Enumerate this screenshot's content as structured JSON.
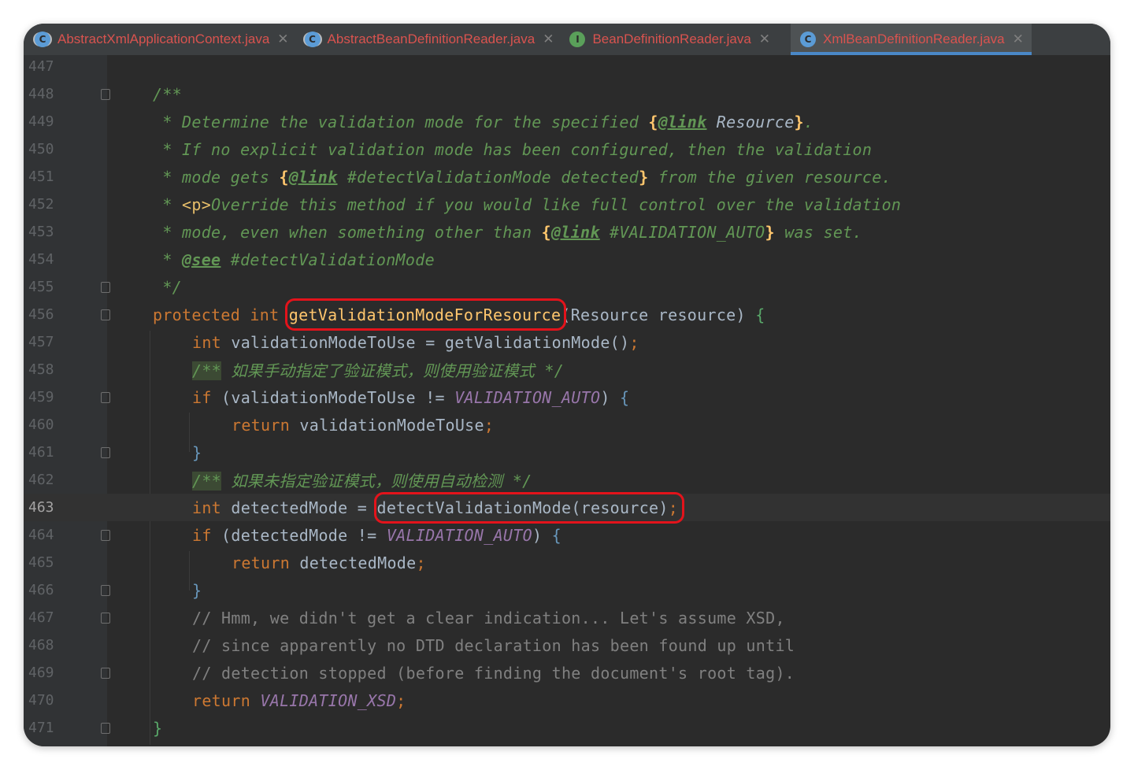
{
  "tabs": [
    {
      "label": "AbstractXmlApplicationContext.java",
      "icon": "abstract-class-icon",
      "active": false
    },
    {
      "label": "AbstractBeanDefinitionReader.java",
      "icon": "abstract-class-icon",
      "active": false
    },
    {
      "label": "BeanDefinitionReader.java",
      "icon": "interface-icon",
      "active": false
    },
    {
      "label": "XmlBeanDefinitionReader.java",
      "icon": "class-icon",
      "active": true
    }
  ],
  "close_glyph": "✕",
  "current_line": "463",
  "lines": {
    "l447": {
      "n": "447"
    },
    "l448": {
      "n": "448",
      "t1": "/**"
    },
    "l449": {
      "n": "449",
      "t1": " * Determine the validation mode for the specified ",
      "b1": "{",
      "tag": "@link",
      "ref": " Resource",
      "b2": "}",
      "t2": "."
    },
    "l450": {
      "n": "450",
      "t1": " * If no explicit validation mode has been configured, then the validation"
    },
    "l451": {
      "n": "451",
      "t1": " * mode gets ",
      "b1": "{",
      "tag": "@link",
      "ref": " #detectValidationMode detected",
      "b2": "}",
      "t2": " from the given resource."
    },
    "l452": {
      "n": "452",
      "t1": " * ",
      "html": "<p>",
      "t2": "Override this method if you would like full control over the validation"
    },
    "l453": {
      "n": "453",
      "t1": " * mode, even when something other than ",
      "b1": "{",
      "tag": "@link",
      "ref": " #VALIDATION_AUTO",
      "b2": "}",
      "t2": " was set."
    },
    "l454": {
      "n": "454",
      "t1": " * ",
      "tag": "@see",
      "t2": " #detectValidationMode"
    },
    "l455": {
      "n": "455",
      "t1": " */"
    },
    "l456": {
      "n": "456",
      "kw1": "protected",
      "kw2": "int",
      "fn": "getValidationModeForResource",
      "rest": "(Resource resource) ",
      "brace": "{"
    },
    "l457": {
      "n": "457",
      "kw1": "int",
      "rest": " validationModeToUse = getValidationMode()",
      "semi": ";"
    },
    "l458": {
      "n": "458",
      "open": "/**",
      "t1": " 如果手动指定了验证模式，则使用验证模式 ",
      "close": "*/"
    },
    "l459": {
      "n": "459",
      "kw1": "if",
      "rest": " (validationModeToUse != ",
      "const": "VALIDATION_AUTO",
      "rest2": ") ",
      "brace": "{"
    },
    "l460": {
      "n": "460",
      "kw1": "return",
      "rest": " validationModeToUse",
      "semi": ";"
    },
    "l461": {
      "n": "461",
      "brace": "}"
    },
    "l462": {
      "n": "462",
      "open": "/**",
      "t1": " 如果未指定验证模式，则使用自动检测 ",
      "close": "*/"
    },
    "l463": {
      "n": "463",
      "kw1": "int",
      "rest": " detectedMode = ",
      "call": "detectValidationMode(resource)",
      "semi": ";"
    },
    "l464": {
      "n": "464",
      "kw1": "if",
      "rest": " (detectedMode != ",
      "const": "VALIDATION_AUTO",
      "rest2": ") ",
      "brace": "{"
    },
    "l465": {
      "n": "465",
      "kw1": "return",
      "rest": " detectedMode",
      "semi": ";"
    },
    "l466": {
      "n": "466",
      "brace": "}"
    },
    "l467": {
      "n": "467",
      "t1": "// Hmm, we didn't get a clear indication... Let's assume XSD,"
    },
    "l468": {
      "n": "468",
      "t1": "// since apparently no DTD declaration has been found up until"
    },
    "l469": {
      "n": "469",
      "t1": "// detection stopped (before finding the document's root tag)."
    },
    "l470": {
      "n": "470",
      "kw1": "return",
      "const": "VALIDATION_XSD",
      "semi": ";"
    },
    "l471": {
      "n": "471",
      "brace": "}"
    }
  },
  "colors": {
    "background": "#2b2b2b",
    "keyword": "#cc7832",
    "method": "#ffc66d",
    "constant": "#9876aa",
    "doc": "#629755",
    "comment": "#808080",
    "highlight_box": "#e3131b"
  }
}
